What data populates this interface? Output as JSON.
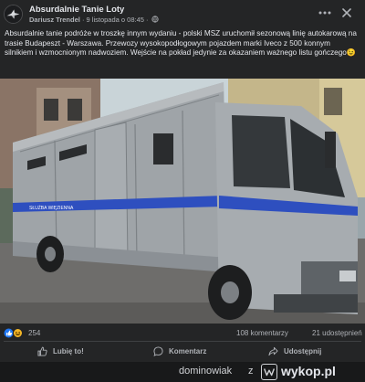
{
  "post": {
    "group_name": "Absurdalnie Tanie Loty",
    "author": "Dariusz Trendel",
    "separator": "·",
    "date": "9 listopada o 08:45",
    "separator2": "·",
    "text": "Absurdalnie tanie podróże w troszkę innym wydaniu - polski MSZ uruchomił sezonową linię autokarową na trasie Budapeszt - Warszawa. Przewozy wysokopodłogowym pojazdem marki Iveco z 500 konnym silnikiem i wzmocnionym nadwoziem. Wejście na pokład jedynie za okazaniem ważnego listu gończego😉",
    "photo_side_text": "SŁUŻBA WIĘZIENNA"
  },
  "counts": {
    "reactions": "254",
    "comments": "108 komentarzy",
    "shares": "21 udostępnień"
  },
  "actions": {
    "like": "Lubię to!",
    "comment": "Komentarz",
    "share": "Udostępnij"
  },
  "watermark": {
    "user": "dominowiak",
    "z": "z",
    "site": "wykop.pl"
  },
  "colors": {
    "background": "#18191a",
    "card": "#242526",
    "text": "#e4e6eb",
    "secondary": "#b0b3b8",
    "like_blue": "#2078f4",
    "haha_yellow": "#f7b928"
  },
  "icons": [
    "group-avatar-icon",
    "globe-icon",
    "more-options-icon",
    "close-icon",
    "like-reaction-icon",
    "haha-reaction-icon",
    "thumbs-up-icon",
    "comment-icon",
    "share-icon",
    "wykop-logo-icon"
  ]
}
